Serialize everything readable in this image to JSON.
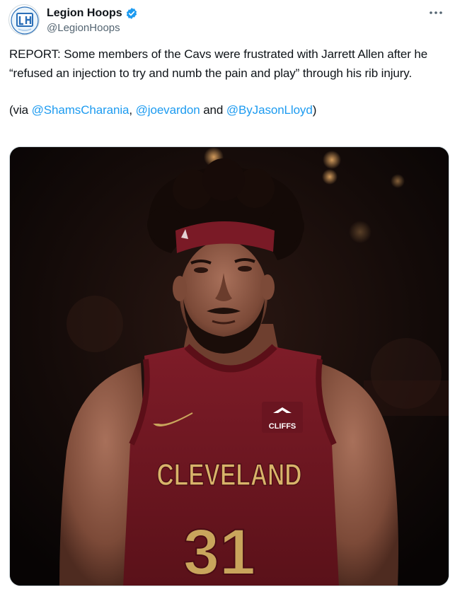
{
  "author": {
    "display_name": "Legion Hoops",
    "handle": "@LegionHoops",
    "verified": true,
    "avatar_icon": "legion-hoops-logo-icon"
  },
  "tweet": {
    "text": "REPORT: Some members of the Cavs were frustrated with Jarrett Allen after he “refused an injection to try and numb the pain and play” through his rib injury.",
    "via_open": "(via ",
    "mention_1": "@ShamsCharania",
    "sep_1": ", ",
    "mention_2": "@joevardon",
    "sep_2": " and ",
    "mention_3": "@ByJasonLloyd",
    "via_close": ")"
  },
  "media": {
    "type": "photo",
    "jersey_team_text": "CLEVELAND",
    "jersey_number": "31",
    "jersey_sponsor": "CLIFFS"
  },
  "colors": {
    "accent": "#1d9bf0",
    "text": "#0f1419",
    "secondary_text": "#536471",
    "jersey": "#7a1a26",
    "jersey_gold": "#c9a55c"
  },
  "icons": {
    "more": "more-options-icon",
    "verified": "verified-badge-icon"
  }
}
